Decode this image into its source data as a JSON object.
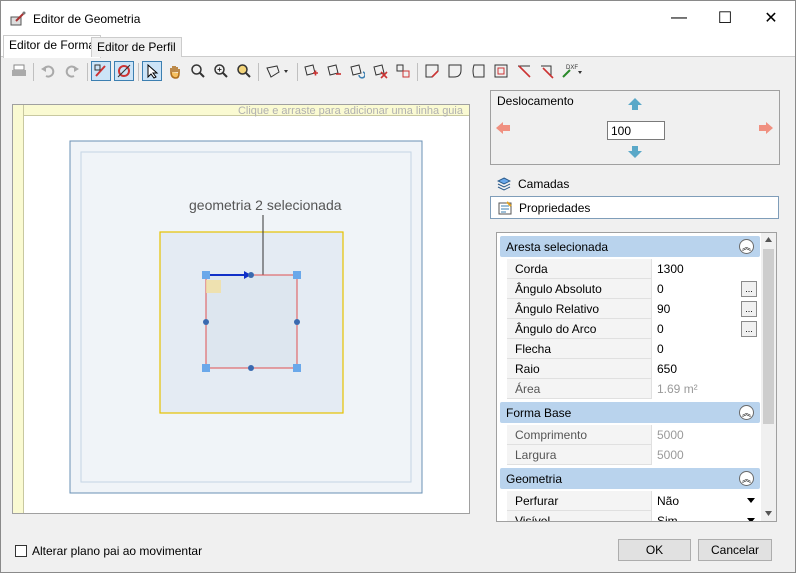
{
  "window": {
    "title": "Editor de Geometria",
    "minimize_glyph": "—",
    "maximize_glyph": "☐",
    "close_glyph": "✕"
  },
  "tabs": [
    {
      "label": "Editor de Forma",
      "active": true
    },
    {
      "label": "Editor de Perfil",
      "active": false
    }
  ],
  "canvas": {
    "guide_hint": "Clique e arraste para adicionar uma linha guia",
    "annotation": "geometria 2 selecionada"
  },
  "offset": {
    "label": "Deslocamento",
    "value": "100"
  },
  "sections": {
    "layers_label": "Camadas",
    "properties_label": "Propriedades"
  },
  "properties": {
    "groups": [
      {
        "title": "Aresta selecionada",
        "rows": [
          {
            "name": "Corda",
            "value": "1300",
            "readonly": false,
            "button": false
          },
          {
            "name": "Ângulo Absoluto",
            "value": "0",
            "readonly": false,
            "button": true
          },
          {
            "name": "Ângulo Relativo",
            "value": "90",
            "readonly": false,
            "button": true
          },
          {
            "name": "Ângulo do Arco",
            "value": "0",
            "readonly": false,
            "button": true
          },
          {
            "name": "Flecha",
            "value": "0",
            "readonly": false,
            "button": false
          },
          {
            "name": "Raio",
            "value": "650",
            "readonly": false,
            "button": false
          },
          {
            "name": "Área",
            "value": "1.69 m²",
            "readonly": true,
            "button": false
          }
        ]
      },
      {
        "title": "Forma Base",
        "rows": [
          {
            "name": "Comprimento",
            "value": "5000",
            "readonly": true,
            "button": false
          },
          {
            "name": "Largura",
            "value": "5000",
            "readonly": true,
            "button": false
          }
        ]
      },
      {
        "title": "Geometria",
        "rows": [
          {
            "name": "Perfurar",
            "value": "Não",
            "readonly": false,
            "button": false,
            "dropdown": true
          },
          {
            "name": "Visível",
            "value": "Sim",
            "readonly": false,
            "button": false,
            "dropdown": true
          }
        ]
      }
    ],
    "ellipsis": "...",
    "collapse_glyph": "︽"
  },
  "footer": {
    "checkbox_label": "Alterar plano pai ao movimentar",
    "ok": "OK",
    "cancel": "Cancelar"
  },
  "colors": {
    "accent": "#3c7fb1",
    "selection_yellow": "#e6c200",
    "edge_red": "#e05050",
    "node_blue": "#6aa8ea"
  }
}
